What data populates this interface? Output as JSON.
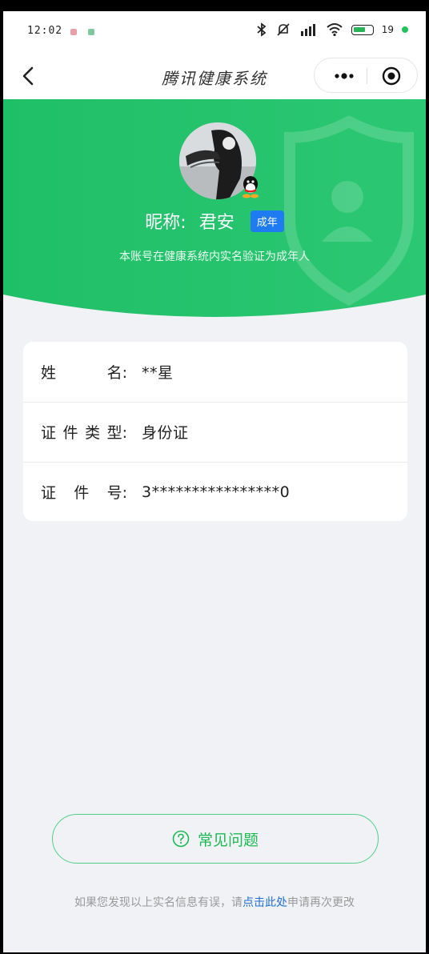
{
  "status_bar": {
    "time": "12:02",
    "battery_percent": "19",
    "icons": [
      "bluetooth-icon",
      "mute-icon",
      "signal-icon",
      "wifi-icon",
      "battery-icon"
    ]
  },
  "nav": {
    "title": "腾讯健康系统",
    "icons": [
      "back-icon",
      "more-icon",
      "close-target-icon"
    ]
  },
  "profile": {
    "nickname_label": "昵称:",
    "nickname": "君安",
    "badge": "成年",
    "verify_text": "本账号在健康系统内实名验证为成年人"
  },
  "info": {
    "rows": [
      {
        "label": [
          "姓",
          "名:"
        ],
        "value": "**星"
      },
      {
        "label": [
          "证",
          "件",
          "类",
          "型:"
        ],
        "value": "身份证"
      },
      {
        "label": [
          "证",
          "件",
          "号:"
        ],
        "value": "3****************0"
      }
    ]
  },
  "faq": {
    "label": "常见问题"
  },
  "footer": {
    "prefix": "如果您发现以上实名信息有误，请",
    "link": "点击此处",
    "suffix": "申请再次更改"
  },
  "colors": {
    "brand_green": "#1db955",
    "header_green": "#22c066",
    "badge_blue": "#1e7bf2",
    "link_blue": "#1e6fd9",
    "page_bg": "#f0f2f5"
  }
}
